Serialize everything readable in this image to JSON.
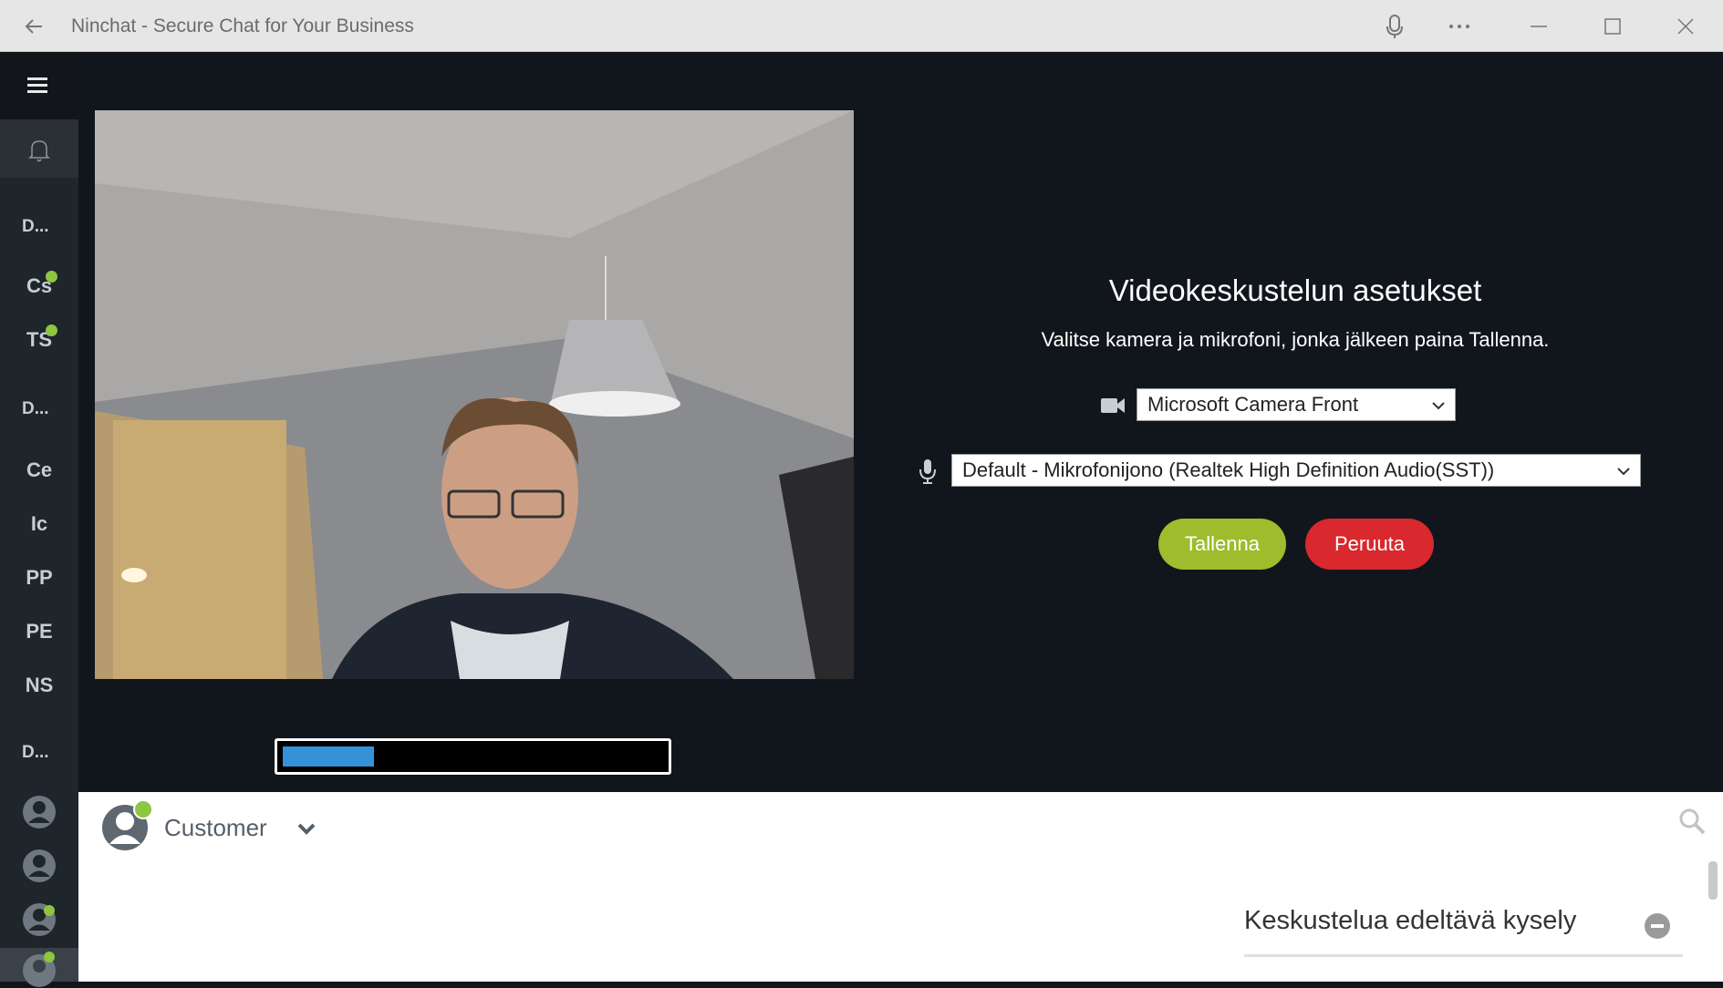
{
  "window": {
    "title": "Ninchat - Secure Chat for Your Business"
  },
  "sidebar": {
    "categories": [
      "D...",
      "D...",
      "D..."
    ],
    "channels_group1": [
      "Cs",
      "TS"
    ],
    "channels_group2": [
      "Ce",
      "Ic",
      "PP",
      "PE",
      "NS"
    ]
  },
  "video_settings": {
    "title": "Videokeskustelun asetukset",
    "description": "Valitse kamera ja mikrofoni, jonka jälkeen paina Tallenna.",
    "camera_selected": "Microsoft Camera Front",
    "microphone_selected": "Default - Mikrofonijono (Realtek High Definition Audio(SST))",
    "save_label": "Tallenna",
    "cancel_label": "Peruuta",
    "mic_level_fraction": 0.24
  },
  "chat": {
    "contact_name": "Customer",
    "survey_title": "Keskustelua edeltävä kysely"
  },
  "colors": {
    "save": "#9dbd2c",
    "cancel": "#d9282e",
    "online": "#8dc63f",
    "progress": "#3592d8"
  }
}
